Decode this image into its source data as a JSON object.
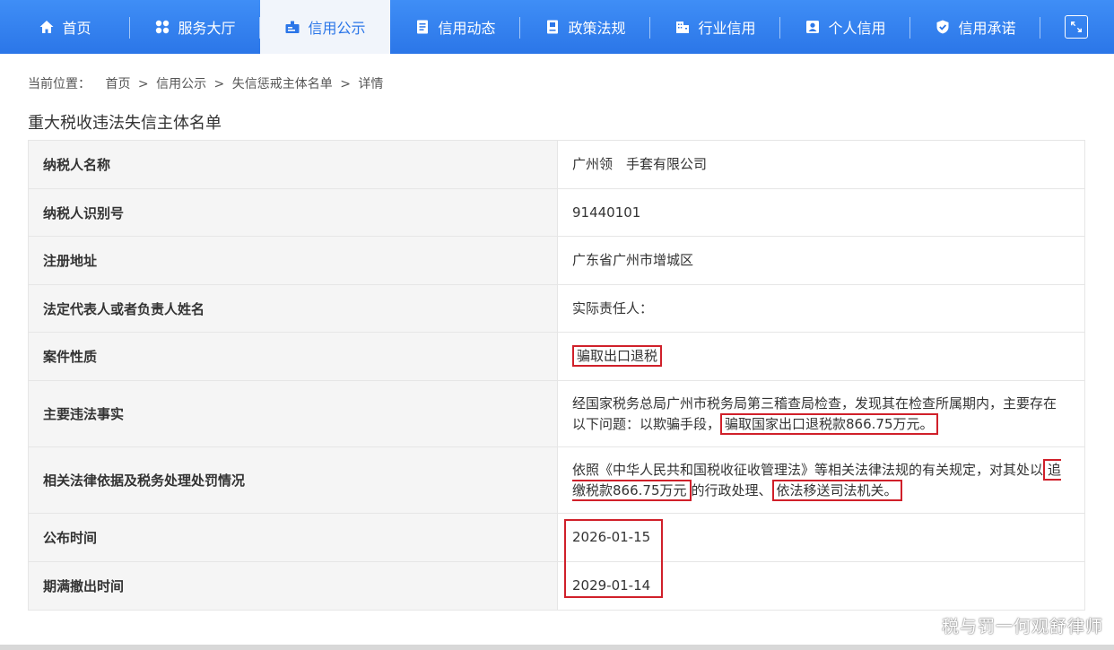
{
  "nav": {
    "items": [
      {
        "label": "首页",
        "icon": "home-icon"
      },
      {
        "label": "服务大厅",
        "icon": "grid-icon"
      },
      {
        "label": "信用公示",
        "icon": "id-card-icon",
        "active": true
      },
      {
        "label": "信用动态",
        "icon": "document-icon"
      },
      {
        "label": "政策法规",
        "icon": "book-icon"
      },
      {
        "label": "行业信用",
        "icon": "building-icon"
      },
      {
        "label": "个人信用",
        "icon": "person-card-icon"
      },
      {
        "label": "信用承诺",
        "icon": "shield-check-icon"
      }
    ],
    "expand_icon": "fullscreen-icon",
    "accent": "#2b76e8"
  },
  "breadcrumb": {
    "lead": "当前位置：",
    "items": [
      "首页",
      "信用公示",
      "失信惩戒主体名单",
      "详情"
    ],
    "separator": ">"
  },
  "page_title": "重大税收违法失信主体名单",
  "rows": [
    {
      "key": "纳税人名称",
      "value": "广州领　手套有限公司"
    },
    {
      "key": "纳税人识别号",
      "value": "91440101"
    },
    {
      "key": "注册地址",
      "value": "广东省广州市增城区"
    },
    {
      "key": "法定代表人或者负责人姓名",
      "value": "实际责任人："
    },
    {
      "key": "案件性质",
      "value": "骗取出口退税"
    },
    {
      "key": "主要违法事实",
      "value_a": "经国家税务总局广州市税务局第三稽查局检查，发现其在检查所属期内，主要存在以下问题：以欺骗手段，",
      "value_hl": "骗取国家出口退税款866.75万元。"
    },
    {
      "key": "相关法律依据及税务处理处罚情况",
      "value_a": "依照《中华人民共和国税收征收管理法》等相关法律法规的有关规定，对其处以",
      "value_hl1": "追缴税款866.75万元",
      "value_b": "的行政处理、",
      "value_hl2": "依法移送司法机关。"
    },
    {
      "key": "公布时间",
      "value": "2026-01-15"
    },
    {
      "key": "期满撤出时间",
      "value": "2029-01-14"
    }
  ],
  "highlight_color": "#d0202a",
  "watermark": "税与罚一何观舒律师"
}
